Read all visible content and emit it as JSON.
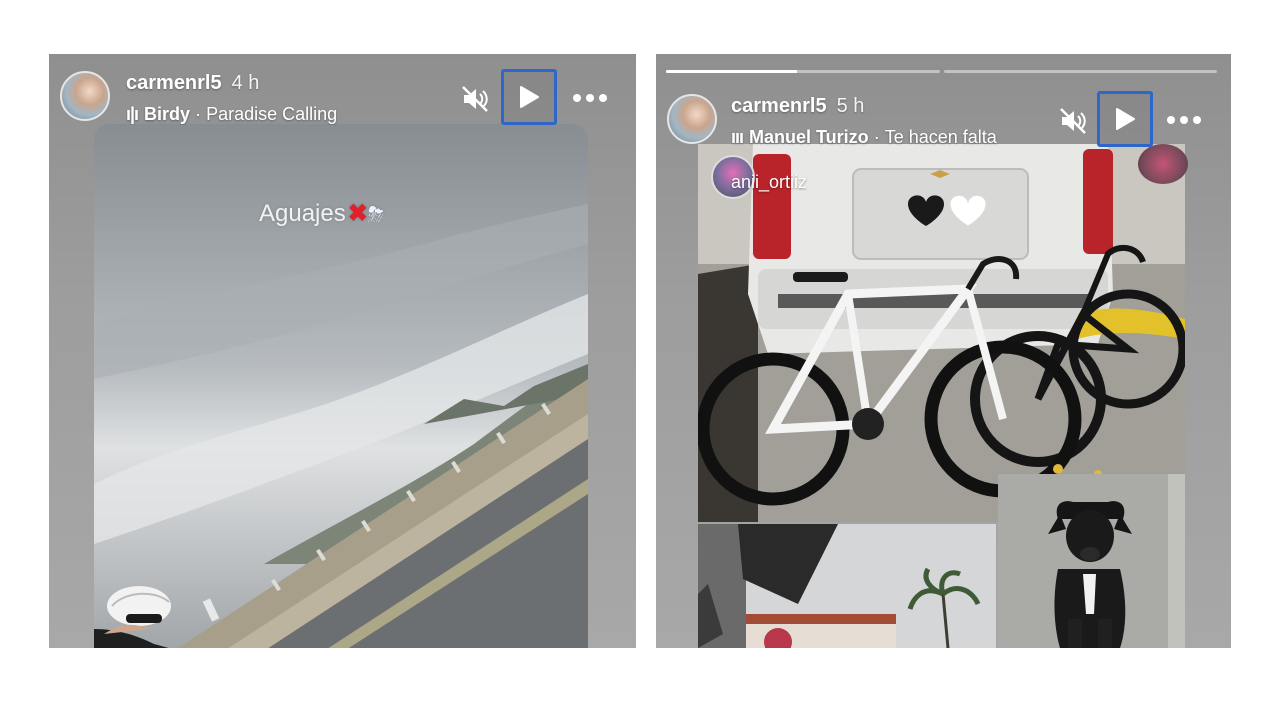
{
  "stories": [
    {
      "username": "carmenrl5",
      "time": "4 h",
      "music_bars": "ı|ı",
      "artist": "Birdy",
      "separator": "·",
      "song": "Paradise Calling",
      "caption": "Aguajes",
      "caption_x": "✖",
      "caption_emoji": "⛈",
      "icons": [
        "speaker-muted-icon",
        "play-icon",
        "more-icon"
      ]
    },
    {
      "username": "carmenrl5",
      "time": "5 h",
      "music_bars": "ııı",
      "artist": "Manuel Turizo",
      "separator": "·",
      "song": "Te hacen falta",
      "tagged_user": "anii_ortiiz",
      "progress": [
        0.48,
        0.0
      ],
      "icons": [
        "speaker-muted-icon",
        "play-icon",
        "more-icon"
      ]
    }
  ],
  "colors": {
    "highlight_border": "#2f66c9",
    "progress_fill": "#ffffff",
    "caption_x": "#e0202a"
  }
}
